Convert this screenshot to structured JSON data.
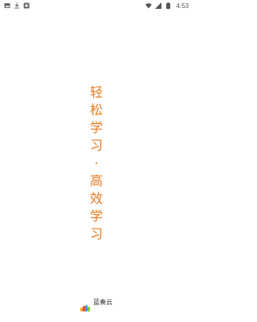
{
  "status_bar": {
    "time": "4:53",
    "left_icons": [
      "image-icon",
      "download-icon",
      "app-icon"
    ],
    "right_icons": [
      "wifi-icon",
      "signal-icon",
      "battery-icon"
    ]
  },
  "splash": {
    "slogan_chars": [
      "轻",
      "松",
      "学",
      "习",
      "·",
      "高",
      "效",
      "学",
      "习"
    ],
    "accent_color": "#e67a1f"
  },
  "brand": {
    "name": "蓝奏云",
    "logo_colors": [
      "#f5a623",
      "#e94e3c",
      "#4a90e2",
      "#7ed321"
    ]
  }
}
